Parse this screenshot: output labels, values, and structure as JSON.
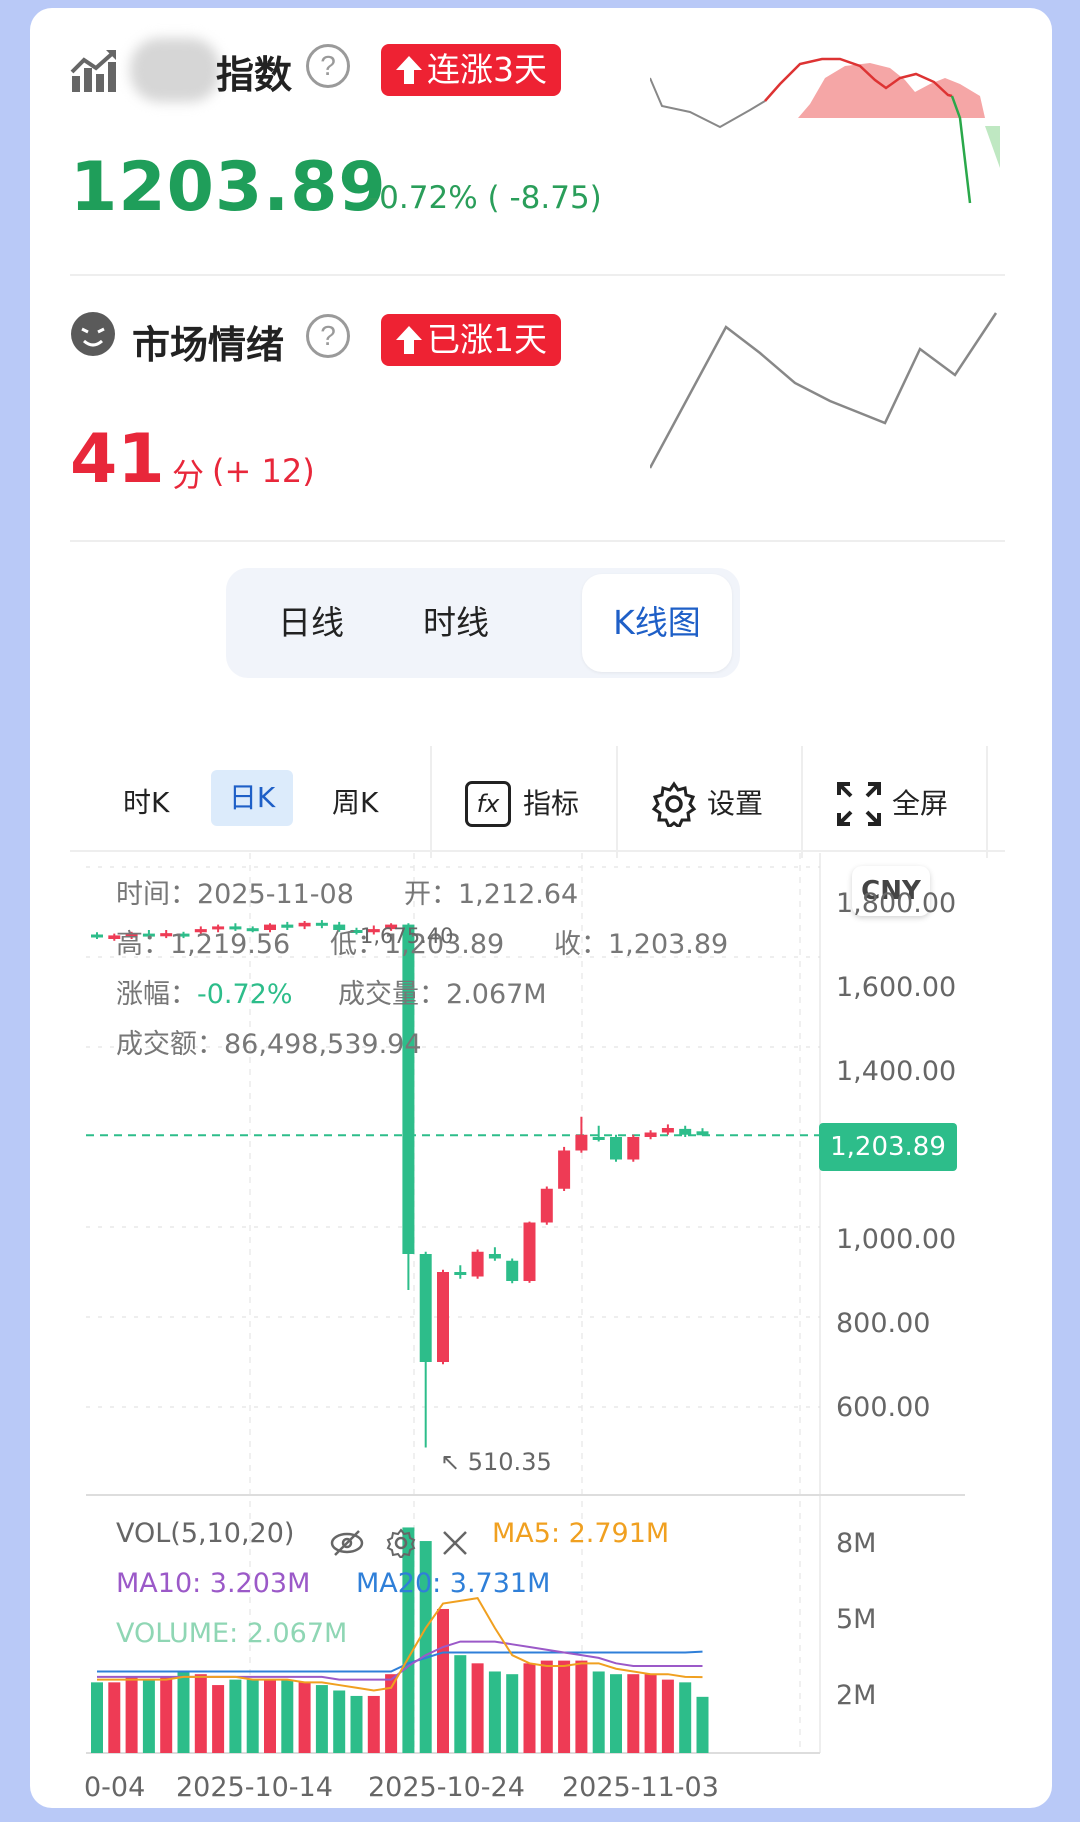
{
  "index": {
    "title": "指数",
    "help": "?",
    "badge": "连涨3天",
    "value": "1203.89",
    "change": "-0.72% ( -8.75)",
    "spark_up_color": "#f5a6a6",
    "spark_down_color": "#bfe8c2"
  },
  "sentiment": {
    "title": "市场情绪",
    "help": "?",
    "badge": "已涨1天",
    "score": "41",
    "score_unit": "分",
    "score_change": "(+ 12)"
  },
  "view_tabs": [
    "日线",
    "时线",
    "K线图"
  ],
  "active_view_tab": "K线图",
  "toolbar": {
    "period_tabs": [
      "时K",
      "日K",
      "周K"
    ],
    "active_period": "日K",
    "indicator_label": "指标",
    "settings_label": "设置",
    "fullscreen_label": "全屏"
  },
  "info_panel": {
    "time_label": "时间：",
    "time_value": "2025-11-08",
    "open_label": "开：",
    "open_value": "1,212.64",
    "high_label": "高：",
    "high_value": "1,219.56",
    "low_label": "低：",
    "low_value": "1,203.89",
    "close_label": "收：",
    "close_value": "1,203.89",
    "pct_label": "涨幅：",
    "pct_value": "-0.72%",
    "vol_label": "成交量：",
    "vol_value": "2.067M",
    "amount_label": "成交额：",
    "amount_value": "86,498,539.94"
  },
  "currency": "CNY",
  "price_axis": {
    "ticks": [
      "1,800.00",
      "1,600.00",
      "1,400.00",
      "1,200.00",
      "1,000.00",
      "800.00",
      "600.00"
    ],
    "current": "1,203.89",
    "max_label": "1,675.40",
    "min_label": "510.35"
  },
  "volume_panel": {
    "title": "VOL(5,10,20)",
    "ma5": "MA5: 2.791M",
    "ma10": "MA10: 3.203M",
    "ma20": "MA20: 3.731M",
    "volume": "VOLUME: 2.067M",
    "ticks": [
      "8M",
      "5M",
      "2M"
    ],
    "ma5_color": "#f0a020",
    "ma10_color": "#9b59c8",
    "ma20_color": "#2f7fd8",
    "volume_color": "#8fd6b4"
  },
  "x_axis": [
    "0-04",
    "2025-10-14",
    "2025-10-24",
    "2025-11-03"
  ],
  "colors": {
    "up": "#ee3b55",
    "down": "#2dbd8a",
    "accent": "#1e5fc7"
  },
  "chart_data": {
    "type": "candlestick",
    "y_range": [
      420,
      1820
    ],
    "candles": [
      {
        "o": 1650,
        "c": 1645,
        "h": 1655,
        "l": 1640,
        "dir": "down"
      },
      {
        "o": 1640,
        "c": 1648,
        "h": 1652,
        "l": 1636,
        "dir": "up"
      },
      {
        "o": 1646,
        "c": 1650,
        "h": 1656,
        "l": 1640,
        "dir": "up"
      },
      {
        "o": 1652,
        "c": 1647,
        "h": 1660,
        "l": 1640,
        "dir": "down"
      },
      {
        "o": 1646,
        "c": 1653,
        "h": 1660,
        "l": 1642,
        "dir": "up"
      },
      {
        "o": 1652,
        "c": 1648,
        "h": 1656,
        "l": 1642,
        "dir": "down"
      },
      {
        "o": 1655,
        "c": 1662,
        "h": 1668,
        "l": 1650,
        "dir": "up"
      },
      {
        "o": 1662,
        "c": 1668,
        "h": 1672,
        "l": 1655,
        "dir": "up"
      },
      {
        "o": 1668,
        "c": 1662,
        "h": 1675,
        "l": 1658,
        "dir": "down"
      },
      {
        "o": 1664,
        "c": 1660,
        "h": 1668,
        "l": 1655,
        "dir": "down"
      },
      {
        "o": 1660,
        "c": 1672,
        "h": 1675,
        "l": 1655,
        "dir": "up"
      },
      {
        "o": 1672,
        "c": 1665,
        "h": 1678,
        "l": 1660,
        "dir": "down"
      },
      {
        "o": 1668,
        "c": 1676,
        "h": 1680,
        "l": 1662,
        "dir": "up"
      },
      {
        "o": 1676,
        "c": 1670,
        "h": 1682,
        "l": 1664,
        "dir": "down"
      },
      {
        "o": 1672,
        "c": 1660,
        "h": 1678,
        "l": 1656,
        "dir": "down"
      },
      {
        "o": 1660,
        "c": 1655,
        "h": 1665,
        "l": 1650,
        "dir": "down"
      },
      {
        "o": 1655,
        "c": 1662,
        "h": 1670,
        "l": 1650,
        "dir": "up"
      },
      {
        "o": 1662,
        "c": 1672,
        "h": 1675,
        "l": 1658,
        "dir": "up"
      },
      {
        "o": 1672,
        "c": 940,
        "h": 1675,
        "l": 860,
        "dir": "down"
      },
      {
        "o": 940,
        "c": 700,
        "h": 945,
        "l": 510,
        "dir": "down"
      },
      {
        "o": 700,
        "c": 900,
        "h": 905,
        "l": 695,
        "dir": "up"
      },
      {
        "o": 900,
        "c": 895,
        "h": 915,
        "l": 885,
        "dir": "down"
      },
      {
        "o": 890,
        "c": 945,
        "h": 950,
        "l": 885,
        "dir": "up"
      },
      {
        "o": 940,
        "c": 930,
        "h": 955,
        "l": 925,
        "dir": "down"
      },
      {
        "o": 925,
        "c": 880,
        "h": 930,
        "l": 875,
        "dir": "down"
      },
      {
        "o": 880,
        "c": 1010,
        "h": 1012,
        "l": 876,
        "dir": "up"
      },
      {
        "o": 1010,
        "c": 1085,
        "h": 1090,
        "l": 1005,
        "dir": "up"
      },
      {
        "o": 1085,
        "c": 1170,
        "h": 1178,
        "l": 1080,
        "dir": "up"
      },
      {
        "o": 1170,
        "c": 1205,
        "h": 1245,
        "l": 1165,
        "dir": "up"
      },
      {
        "o": 1200,
        "c": 1195,
        "h": 1225,
        "l": 1190,
        "dir": "down"
      },
      {
        "o": 1200,
        "c": 1150,
        "h": 1205,
        "l": 1145,
        "dir": "down"
      },
      {
        "o": 1150,
        "c": 1200,
        "h": 1205,
        "l": 1145,
        "dir": "up"
      },
      {
        "o": 1200,
        "c": 1210,
        "h": 1215,
        "l": 1195,
        "dir": "up"
      },
      {
        "o": 1210,
        "c": 1220,
        "h": 1228,
        "l": 1205,
        "dir": "up"
      },
      {
        "o": 1218,
        "c": 1205,
        "h": 1225,
        "l": 1200,
        "dir": "down"
      },
      {
        "o": 1212.64,
        "c": 1203.89,
        "h": 1219.56,
        "l": 1203.89,
        "dir": "down"
      }
    ],
    "volume_range": [
      0,
      9.2
    ],
    "volumes": [
      2.6,
      2.6,
      2.8,
      2.7,
      2.8,
      3.0,
      2.9,
      2.5,
      2.7,
      2.7,
      2.7,
      2.7,
      2.6,
      2.5,
      2.3,
      2.1,
      2.1,
      2.9,
      8.3,
      7.8,
      5.3,
      3.6,
      3.3,
      3.0,
      2.9,
      3.3,
      3.4,
      3.4,
      3.4,
      3.0,
      2.9,
      2.9,
      2.9,
      2.7,
      2.6,
      2.067
    ],
    "ma5": [
      2.7,
      2.7,
      2.7,
      2.7,
      2.7,
      2.8,
      2.8,
      2.8,
      2.8,
      2.7,
      2.7,
      2.7,
      2.6,
      2.6,
      2.5,
      2.4,
      2.3,
      2.4,
      3.5,
      4.6,
      5.5,
      5.6,
      5.7,
      4.6,
      3.6,
      3.3,
      3.2,
      3.2,
      3.3,
      3.3,
      3.1,
      3.0,
      2.9,
      2.9,
      2.8,
      2.791
    ],
    "ma10": [
      2.8,
      2.8,
      2.8,
      2.8,
      2.8,
      2.8,
      2.8,
      2.8,
      2.8,
      2.8,
      2.8,
      2.8,
      2.8,
      2.8,
      2.7,
      2.7,
      2.7,
      2.7,
      3.2,
      3.6,
      3.9,
      4.1,
      4.1,
      4.1,
      4.0,
      3.9,
      3.8,
      3.7,
      3.6,
      3.5,
      3.3,
      3.2,
      3.2,
      3.2,
      3.2,
      3.203
    ],
    "ma20": [
      3.0,
      3.0,
      3.0,
      3.0,
      3.0,
      3.0,
      3.0,
      3.0,
      3.0,
      3.0,
      3.0,
      3.0,
      3.0,
      3.0,
      3.0,
      3.0,
      3.0,
      3.0,
      3.3,
      3.5,
      3.7,
      3.7,
      3.7,
      3.7,
      3.7,
      3.7,
      3.7,
      3.7,
      3.7,
      3.7,
      3.7,
      3.7,
      3.7,
      3.7,
      3.7,
      3.731
    ]
  }
}
